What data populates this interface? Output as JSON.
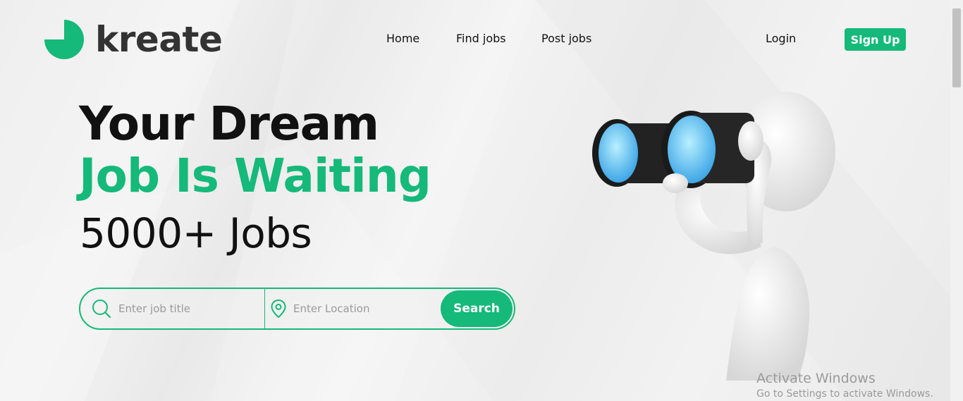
{
  "brand": {
    "name": "kreate",
    "accent_color": "#15b97a"
  },
  "nav": {
    "links": [
      {
        "label": "Home"
      },
      {
        "label": "Find jobs"
      },
      {
        "label": "Post jobs"
      }
    ],
    "login_label": "Login",
    "signup_label": "Sign Up"
  },
  "hero": {
    "line1": "Your Dream",
    "line2": "Job Is Waiting",
    "line3": "5000+ Jobs"
  },
  "search": {
    "job_placeholder": "Enter job title",
    "location_placeholder": "Enter Location",
    "button_label": "Search",
    "job_icon": "search-icon",
    "location_icon": "location-pin-icon"
  },
  "watermark": {
    "title": "Activate Windows",
    "subtitle": "Go to Settings to activate Windows."
  }
}
